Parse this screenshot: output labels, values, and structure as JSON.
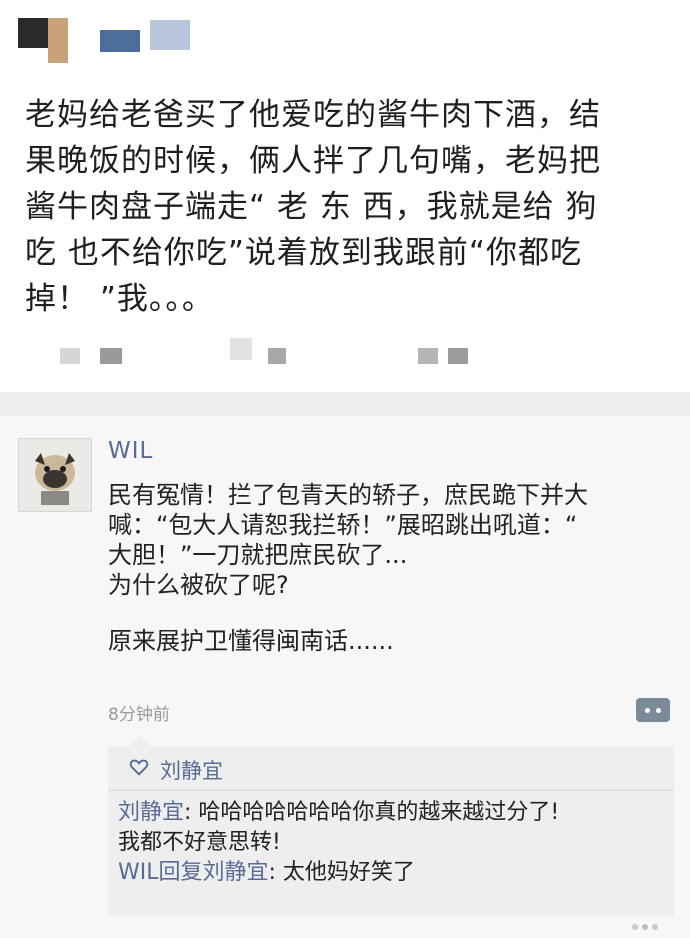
{
  "post": {
    "lines": [
      "老妈给老爸买了他爱吃的酱牛肉下酒，结",
      "果晚饭的时候，俩人拌了几句嘴，老妈把",
      "酱牛肉盘子端走“ 老 东 西，我就是给 狗",
      "吃 也不给你吃”说着放到我跟前“你都吃",
      "掉！ ”我。。。"
    ]
  },
  "moment": {
    "username": "WIL",
    "comment_lines": [
      "民有冤情！拦了包青天的轿子，庶民跪下并大",
      "喊：“包大人请恕我拦轿！”展昭跳出吼道：“",
      "大胆！”一刀就把庶民砍了...",
      "为什么被砍了呢?",
      "原来展护卫懂得闽南话......"
    ],
    "timestamp": "8分钟前",
    "likes": "刘静宜",
    "replies": [
      {
        "name": "刘静宜",
        "sep": ": ",
        "text": "哈哈哈哈哈哈哈你真的越来越过分了!"
      },
      {
        "name": "",
        "sep": "",
        "text": "我都不好意思转!"
      },
      {
        "name": "WIL回复刘静宜",
        "sep": ": ",
        "text": "太他妈好笑了"
      }
    ]
  },
  "colors": {
    "link": "#576b95",
    "text": "#222222",
    "muted": "#9a9a9a"
  },
  "icons": [
    "heart-icon",
    "comment-action-icon",
    "avatar"
  ]
}
